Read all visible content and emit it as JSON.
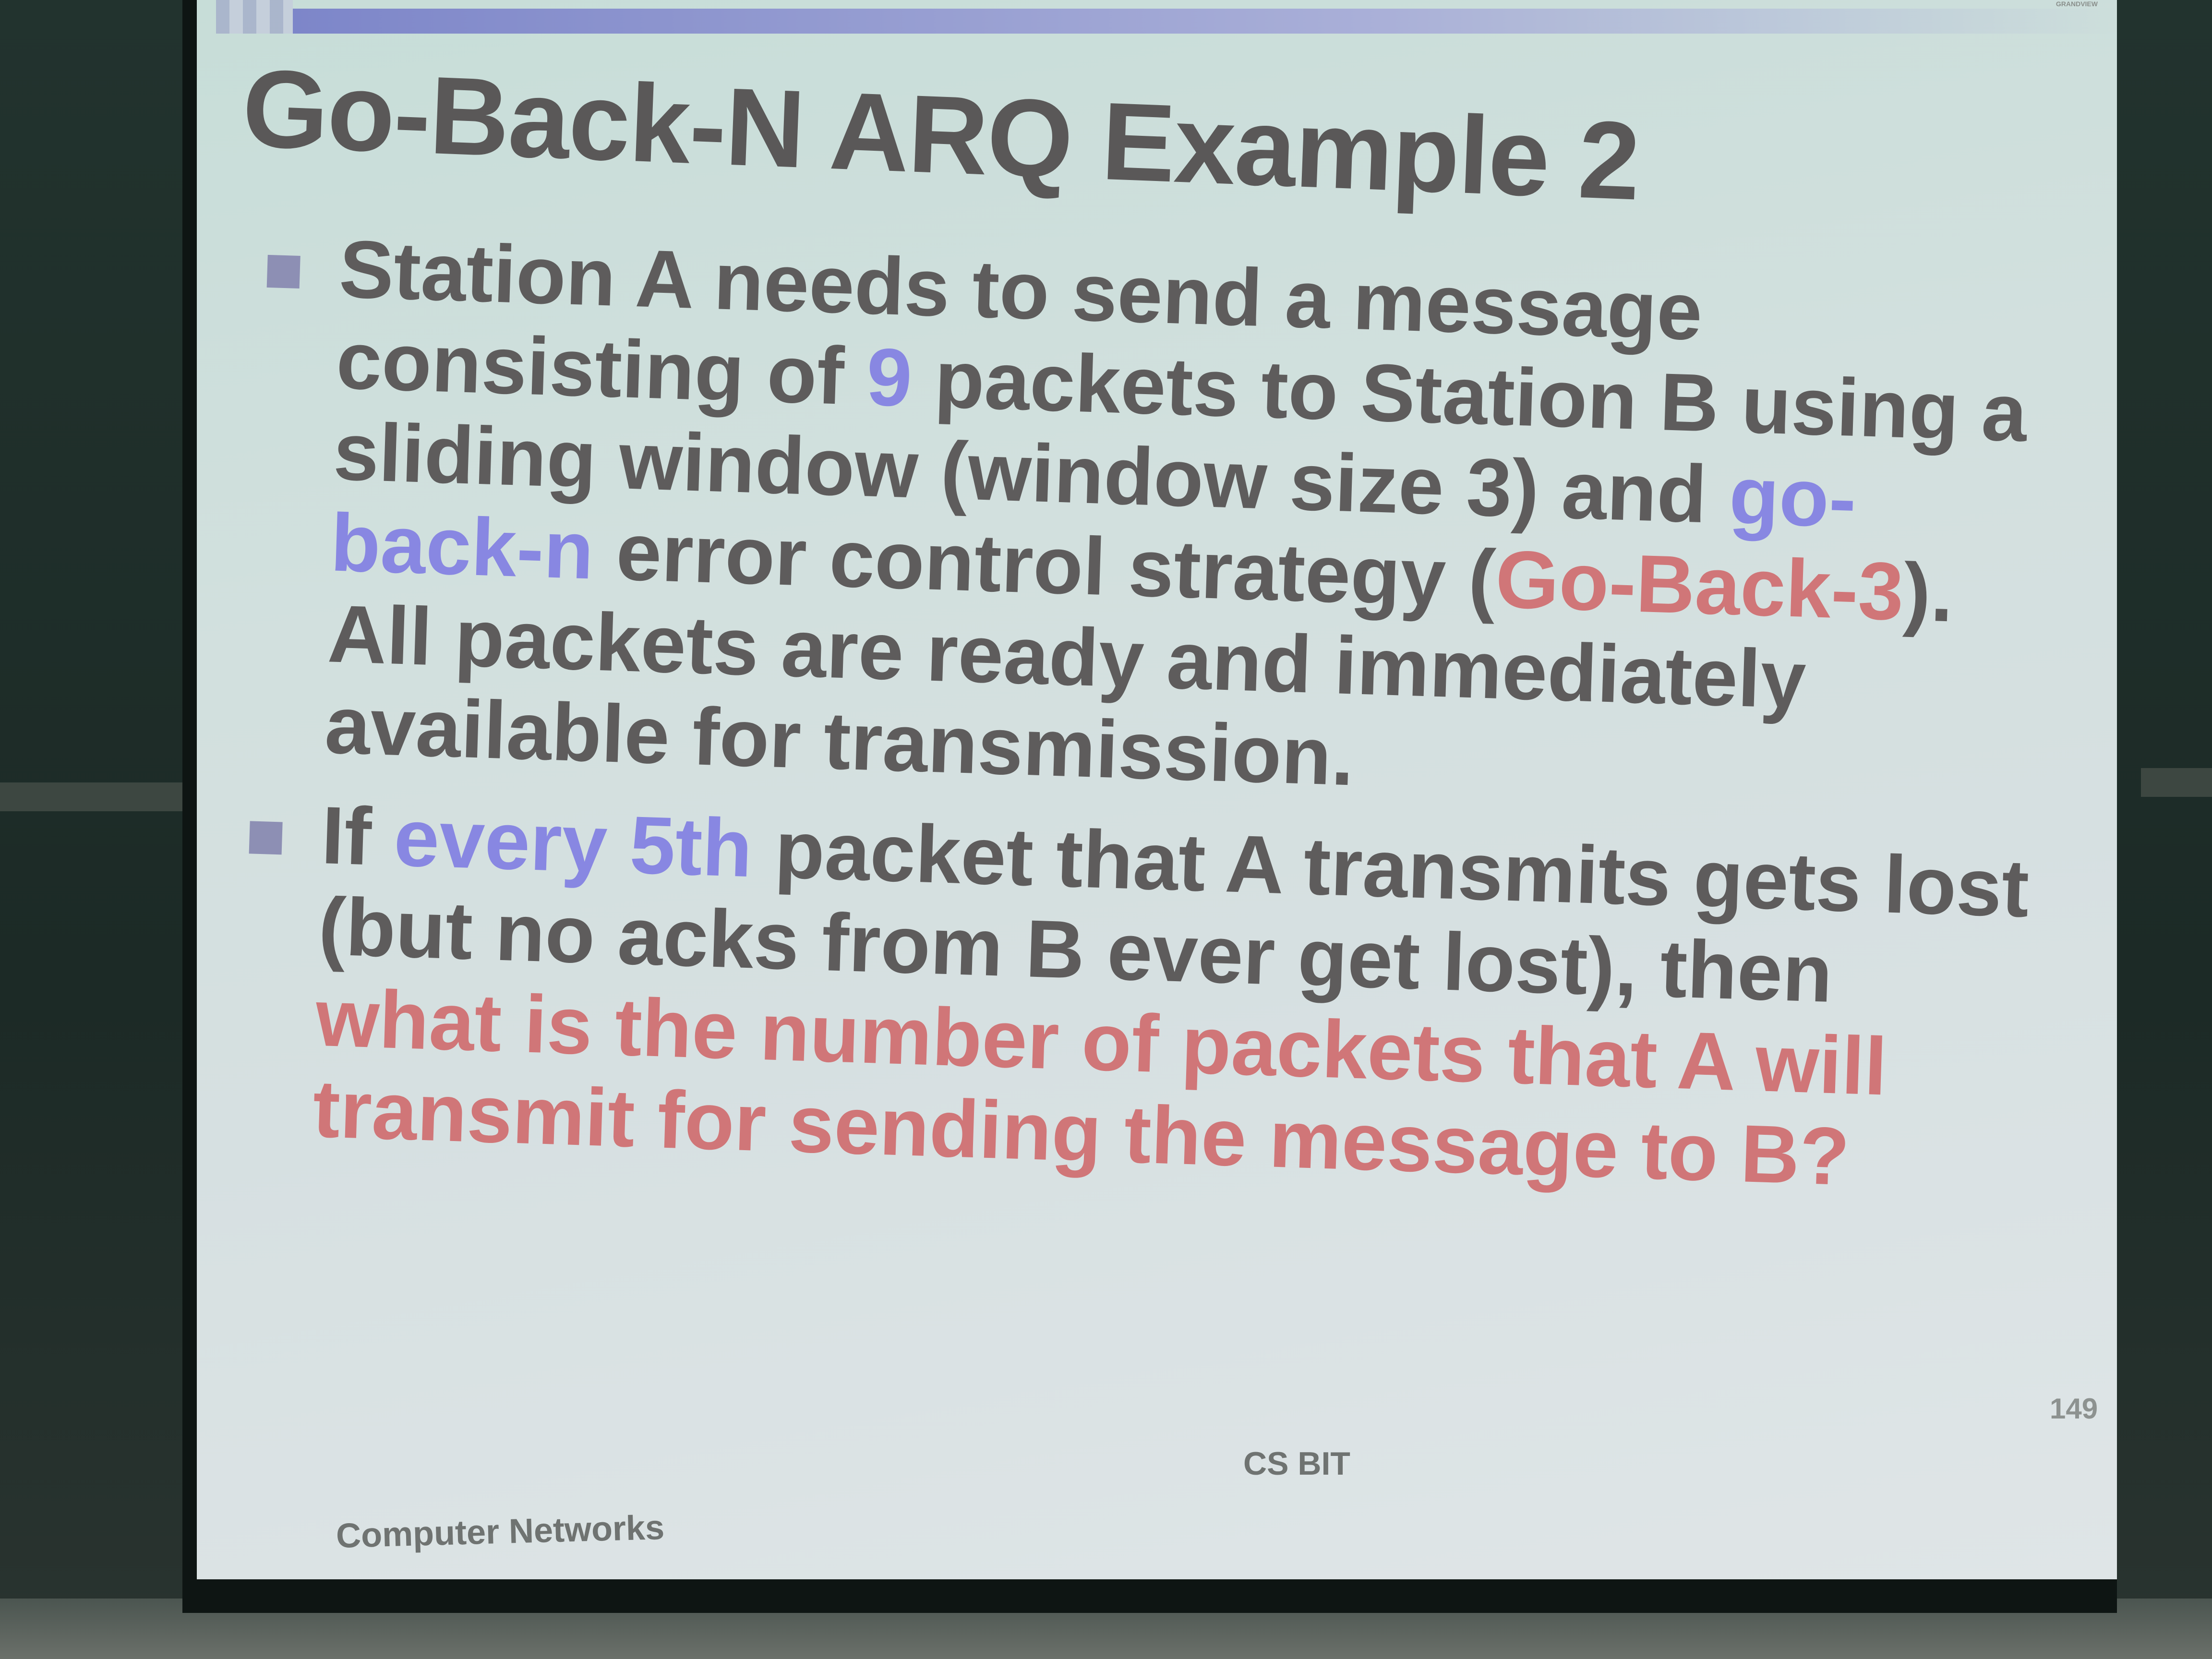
{
  "projector": {
    "brand": "GRANDVIEW"
  },
  "slide": {
    "title": "Go-Back-N ARQ Example 2",
    "bullets": [
      {
        "parts": [
          {
            "text": "Station A needs to send a message consisting of ",
            "style": "normal"
          },
          {
            "text": "9",
            "style": "blue"
          },
          {
            "text": " packets to Station B using a sliding window (window size 3) and ",
            "style": "normal"
          },
          {
            "text": "go-back-n",
            "style": "blue"
          },
          {
            "text": " error control strategy (",
            "style": "normal"
          },
          {
            "text": "Go-Back-3",
            "style": "red"
          },
          {
            "text": "). All packets are ready and immediately available for transmission.",
            "style": "normal"
          }
        ]
      },
      {
        "parts": [
          {
            "text": "If ",
            "style": "normal"
          },
          {
            "text": "every 5th",
            "style": "blue"
          },
          {
            "text": " packet that A transmits gets lost (but no acks from B ever get lost), then ",
            "style": "normal"
          },
          {
            "text": "what is the number of packets that A will transmit for sending the message to B?",
            "style": "red"
          }
        ]
      }
    ],
    "footer_left": "Computer Networks",
    "footer_center": "CS BIT",
    "page_number": "149"
  },
  "colors": {
    "title": "#5a5858",
    "body_text": "#5e5c5c",
    "highlight_blue": "#8887e2",
    "highlight_red": "#d07678",
    "bullet_marker": "#8d8fb4"
  }
}
